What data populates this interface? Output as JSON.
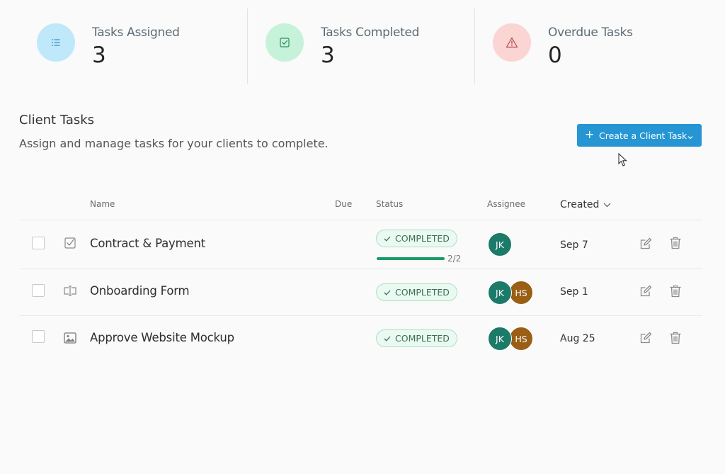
{
  "stats": [
    {
      "label": "Tasks Assigned",
      "value": "3",
      "icon": "list-icon",
      "color": "#bfe8fb"
    },
    {
      "label": "Tasks Completed",
      "value": "3",
      "icon": "checkbox-icon",
      "color": "#c7f2da"
    },
    {
      "label": "Overdue Tasks",
      "value": "0",
      "icon": "warning-icon",
      "color": "#fbd4d4"
    }
  ],
  "section": {
    "title": "Client Tasks",
    "subtitle": "Assign and manage tasks for your clients to complete."
  },
  "create_button": {
    "label": "Create a Client Task",
    "color": "#2596d3"
  },
  "table": {
    "headers": {
      "name": "Name",
      "due": "Due",
      "status": "Status",
      "assignee": "Assignee",
      "created": "Created"
    },
    "rows": [
      {
        "name": "Contract & Payment",
        "type_icon": "checkbox-icon",
        "due": "",
        "status": "COMPLETED",
        "progress_text": "2/2",
        "progress": 1.0,
        "assignees": [
          {
            "initials": "JK",
            "color": "#1b7a68"
          }
        ],
        "created": "Sep 7"
      },
      {
        "name": "Onboarding Form",
        "type_icon": "text-field-icon",
        "due": "",
        "status": "COMPLETED",
        "assignees": [
          {
            "initials": "JK",
            "color": "#1b7a68"
          },
          {
            "initials": "HS",
            "color": "#9a5e14"
          }
        ],
        "created": "Sep 1"
      },
      {
        "name": "Approve Website Mockup",
        "type_icon": "image-icon",
        "due": "",
        "status": "COMPLETED",
        "assignees": [
          {
            "initials": "JK",
            "color": "#1b7a68"
          },
          {
            "initials": "HS",
            "color": "#9a5e14"
          }
        ],
        "created": "Aug 25"
      }
    ]
  }
}
